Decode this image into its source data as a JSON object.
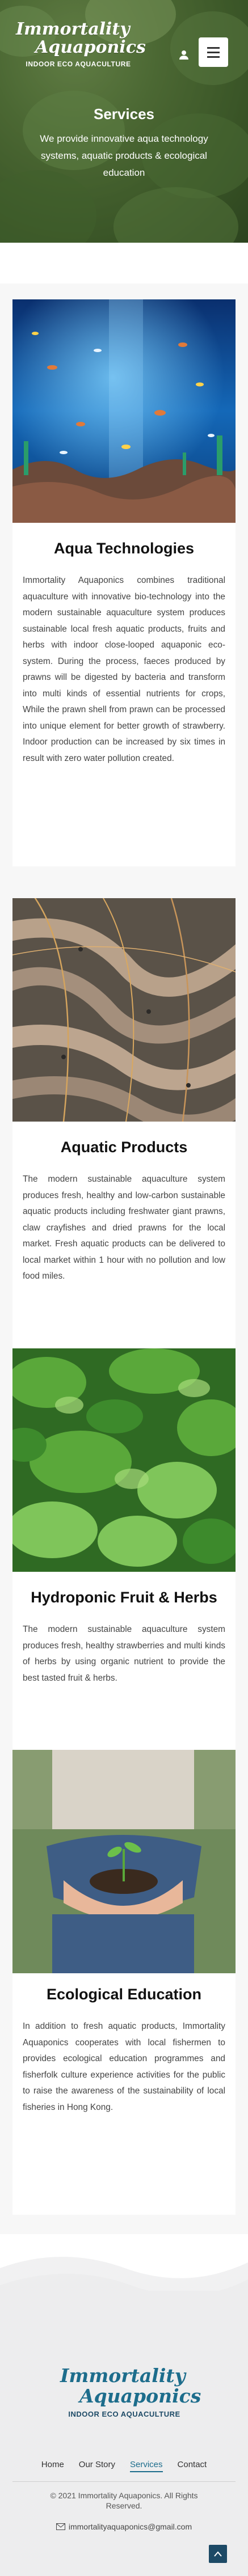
{
  "brand": {
    "line1": "Immortality",
    "line2": "Aquaponics",
    "tagline": "INDOOR ECO AQUACULTURE"
  },
  "hero": {
    "title": "Services",
    "text": "We provide innovative aqua technology systems, aquatic products & ecological education"
  },
  "sections": [
    {
      "title": "Aqua Technologies",
      "text": "Immortality Aquaponics combines traditional aquaculture with innovative bio-technology into the modern sustainable aquaculture system produces sustainable local fresh aquatic products, fruits and herbs with indoor close-looped aquaponic eco-system. During the process, faeces produced by prawns will be digested by bacteria and transform into multi kinds of essential nutrients for crops, While the prawn shell from prawn can be processed into unique element for better growth of strawberry. Indoor production can be increased by six times in result with zero water pollution created."
    },
    {
      "title": "Aquatic Products",
      "text": "The modern sustainable aquaculture system produces fresh, healthy and low-carbon sustainable aquatic products including freshwater giant prawns, claw crayfishes and dried prawns for the local market. Fresh aquatic products can be delivered to local market within 1 hour with no pollution and low food miles."
    },
    {
      "title": "Hydroponic Fruit & Herbs",
      "text": "The modern sustainable aquaculture system produces fresh, healthy strawberries and multi kinds of herbs by using organic nutrient to provide the best tasted fruit & herbs."
    },
    {
      "title": "Ecological Education",
      "text": "In addition to fresh aquatic products, Immortality Aquaponics cooperates with local fishermen to provides ecological education programmes and fisherfolk culture experience activities for the public to raise the awareness of the sustainability of local fisheries in Hong Kong."
    }
  ],
  "footer": {
    "nav": [
      "Home",
      "Our Story",
      "Services",
      "Contact"
    ],
    "copyright": "© 2021 Immortality Aquaponics. All Rights Reserved.",
    "email": "immortalityaquaponics@gmail.com"
  },
  "colors": {
    "accent": "#1d6d8c",
    "footer_bg": "#ededee",
    "hero_green": "#5e7f3f"
  }
}
